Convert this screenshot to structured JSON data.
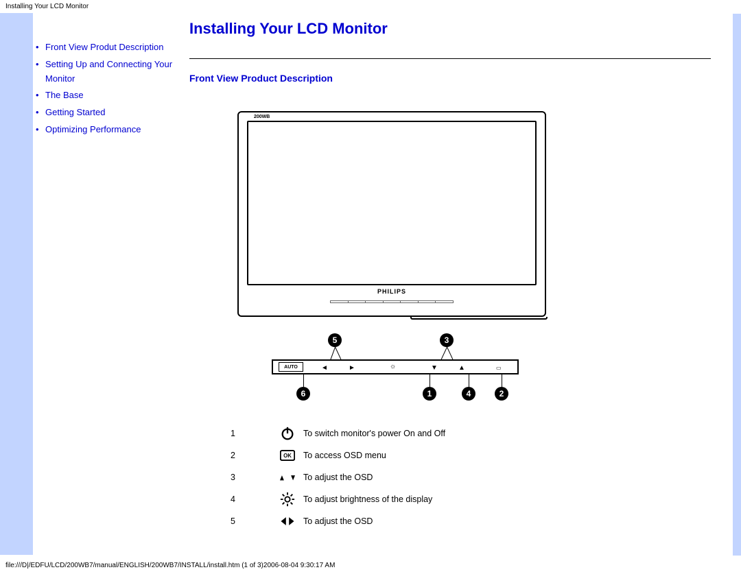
{
  "header": "Installing Your LCD Monitor",
  "sidebar": {
    "items": [
      {
        "label": "Front View Produt Description"
      },
      {
        "label": "Setting Up and Connecting Your Monitor"
      },
      {
        "label": "The Base"
      },
      {
        "label": "Getting Started"
      },
      {
        "label": "Optimizing Performance"
      }
    ]
  },
  "main": {
    "title": "Installing Your LCD Monitor",
    "section_title": "Front View Product Description",
    "monitor_model": "200WB",
    "monitor_logo": "PHILIPS",
    "auto_label": "AUTO",
    "circles": {
      "c1": "1",
      "c2": "2",
      "c3": "3",
      "c4": "4",
      "c5": "5",
      "c6": "6"
    }
  },
  "legend": [
    {
      "num": "1",
      "icon": "power",
      "desc": "To switch monitor's power On and Off"
    },
    {
      "num": "2",
      "icon": "ok",
      "desc": "To access OSD menu"
    },
    {
      "num": "3",
      "icon": "updown",
      "desc": "To adjust the OSD"
    },
    {
      "num": "4",
      "icon": "brightness",
      "desc": "To adjust brightness of the display"
    },
    {
      "num": "5",
      "icon": "leftright",
      "desc": "To adjust the OSD"
    }
  ],
  "footer": "file:///D|/EDFU/LCD/200WB7/manual/ENGLISH/200WB7/INSTALL/install.htm (1 of 3)2006-08-04 9:30:17 AM"
}
